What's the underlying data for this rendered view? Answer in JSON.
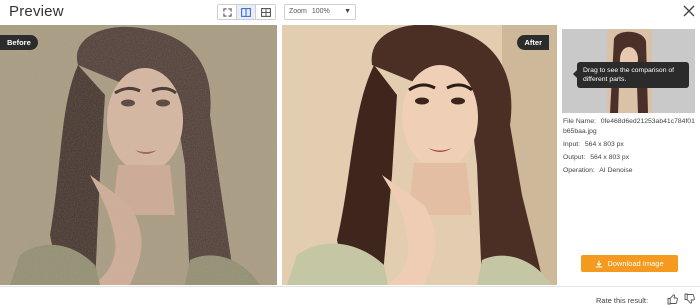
{
  "header": {
    "title": "Preview",
    "view_modes": [
      "fullscreen-icon",
      "split-view-icon",
      "side-by-side-icon"
    ],
    "zoom": {
      "label": "Zoom",
      "value": "100%"
    }
  },
  "before": {
    "badge": "Before"
  },
  "after": {
    "badge": "After"
  },
  "side": {
    "tooltip": "Drag to see the comparison of different parts.",
    "file_name_label": "File Name:",
    "file_name_value": "0fe468d6ed21253ab41c784f01b65baa.jpg",
    "input_label": "Input:",
    "input_value": "564 x 803 px",
    "output_label": "Output:",
    "output_value": "564 x 803 px",
    "operation_label": "Operation:",
    "operation_value": "AI Denoise",
    "download_label": "Download Image"
  },
  "footer": {
    "rate_label": "Rate this result:"
  },
  "colors": {
    "accent": "#f39a1f",
    "badge_bg": "#2c2c2c",
    "tooltip_bg": "#2b2b2b"
  }
}
